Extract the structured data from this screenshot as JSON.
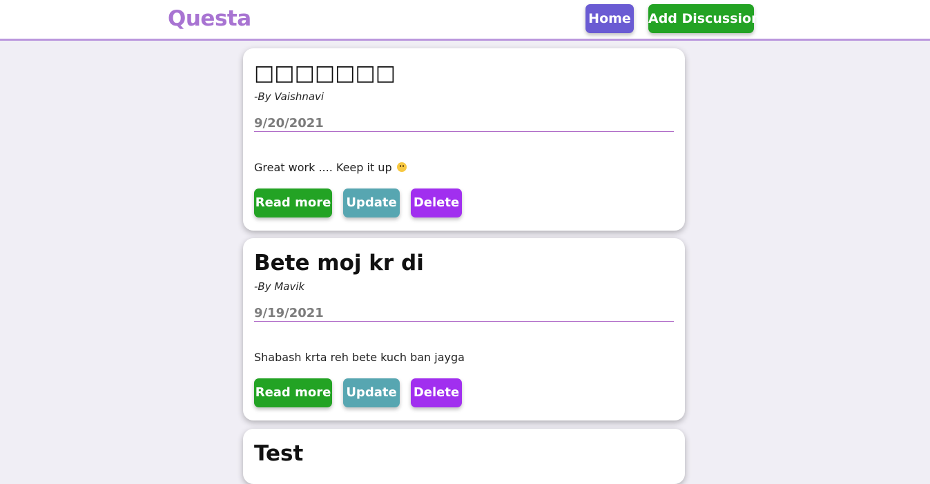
{
  "nav": {
    "brand": "Questa",
    "home_label": "Home",
    "add_label": "Add Discussion"
  },
  "cards": [
    {
      "title": "□□□□□□□",
      "author": "-By Vaishnavi",
      "date": "9/20/2021",
      "description": "Great work .... Keep it up",
      "read_more": "Read more",
      "update": "Update",
      "delete": "Delete"
    },
    {
      "title": "Bete moj kr di",
      "author": "-By Mavik",
      "date": "9/19/2021",
      "description": "Shabash krta reh bete kuch ban jayga",
      "read_more": "Read more",
      "update": "Update",
      "delete": "Delete"
    },
    {
      "title": "Test"
    }
  ],
  "colors": {
    "brand": "#a874d2",
    "home_button": "#6a5bd3",
    "add_button": "#23a324",
    "read_more_button": "#23a324",
    "update_button": "#57a6b1",
    "delete_button": "#a12fef",
    "background": "#f0eef5"
  },
  "icons": {
    "smile": "slightly-smiling-face-emoji"
  }
}
